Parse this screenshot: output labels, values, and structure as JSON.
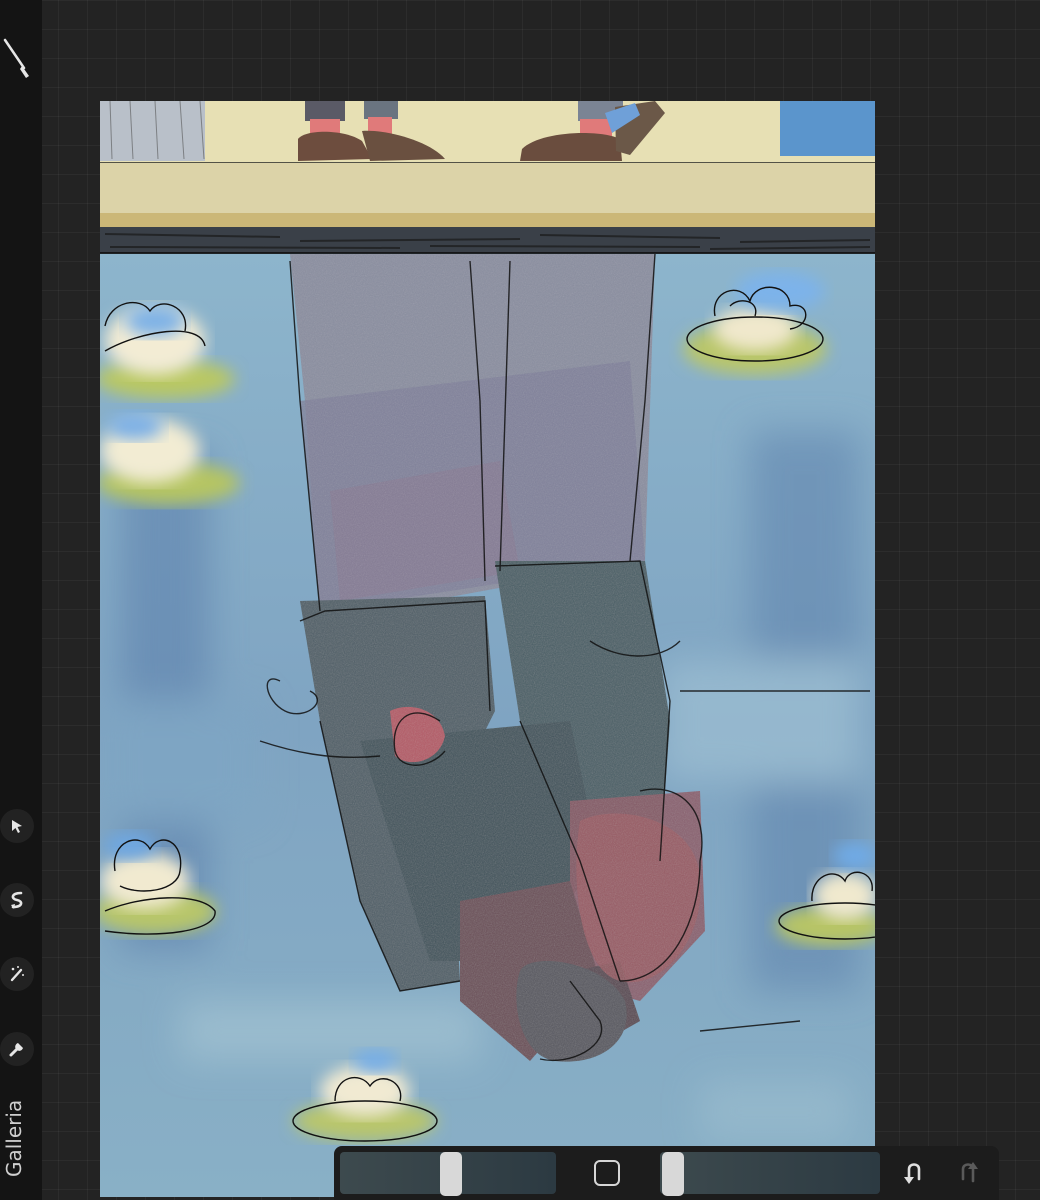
{
  "app": {
    "gallery_label": "Galleria"
  },
  "toolbar": {
    "tools": [
      {
        "name": "brush",
        "icon": "brush-icon"
      },
      {
        "name": "selection",
        "icon": "cursor-arrow-icon"
      },
      {
        "name": "transform",
        "icon": "s-curve-icon"
      },
      {
        "name": "adjustments",
        "icon": "magic-wand-icon"
      },
      {
        "name": "actions",
        "icon": "wrench-icon"
      }
    ]
  },
  "bottom_bar": {
    "brush_size_level": 0.45,
    "opacity_level": 0.0,
    "modify_icon": "square-icon",
    "undo_icon": "undo-icon",
    "redo_icon": "redo-icon"
  },
  "colors": {
    "background": "#232323",
    "toolbar": "#141414",
    "water": "#7fa3c0",
    "sidewalk": "#e4dcb1"
  }
}
